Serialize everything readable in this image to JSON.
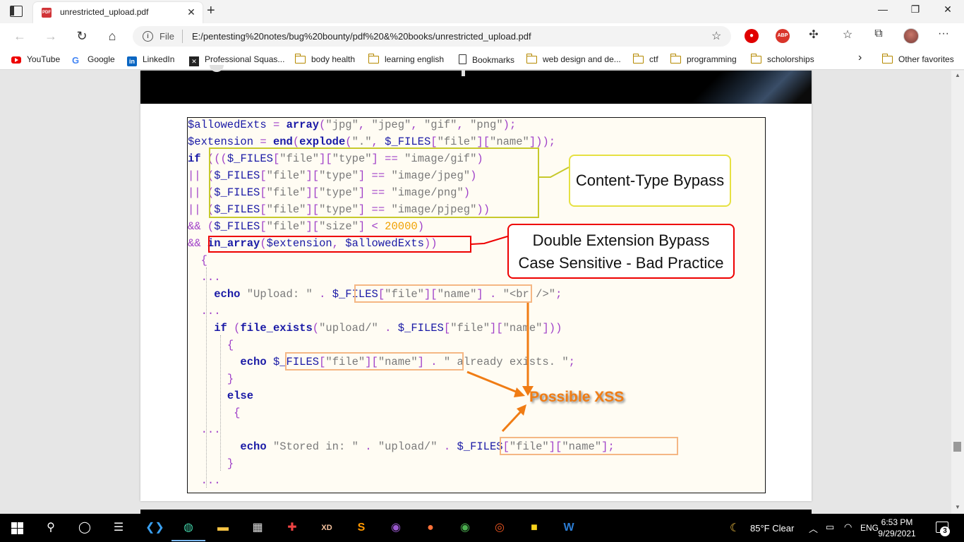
{
  "browser": {
    "tab": {
      "title": "unrestricted_upload.pdf",
      "close": "✕"
    },
    "new_tab": "+",
    "window": {
      "minimize": "—",
      "restore": "❐",
      "close": "✕"
    },
    "address": {
      "scheme_label": "File",
      "url": "E:/pentesting%20notes/bug%20bounty/pdf%20&%20books/unrestricted_upload.pdf"
    },
    "extensions": [
      {
        "name": "ublock-icon",
        "label": "",
        "color": "#e00000"
      },
      {
        "name": "adblock-plus-icon",
        "label": "ABP",
        "color": "#d9352b"
      }
    ],
    "bookmarks": [
      {
        "label": "YouTube",
        "icon": "youtube-icon"
      },
      {
        "label": "Google",
        "icon": "google-icon"
      },
      {
        "label": "LinkedIn",
        "icon": "linkedin-icon"
      },
      {
        "label": "Professional Squas...",
        "icon": "professional-squash-icon"
      },
      {
        "label": "body health",
        "icon": "folder-icon"
      },
      {
        "label": "learning english",
        "icon": "folder-icon"
      },
      {
        "label": "Bookmarks",
        "icon": "page-icon"
      },
      {
        "label": "web design and de...",
        "icon": "folder-icon"
      },
      {
        "label": "ctf",
        "icon": "folder-icon"
      },
      {
        "label": "programming",
        "icon": "folder-icon"
      },
      {
        "label": "scholorships",
        "icon": "folder-icon"
      },
      {
        "label": "Other favorites",
        "icon": "folder-icon"
      }
    ],
    "bookmarks_overflow": "›"
  },
  "pdf": {
    "code_lines": [
      "$allowedExts = array(\"jpg\", \"jpeg\", \"gif\", \"png\");",
      "$extension = end(explode(\".\", $_FILES[\"file\"][\"name\"]));",
      "if ((($_FILES[\"file\"][\"type\"] == \"image/gif\")",
      "|| ($_FILES[\"file\"][\"type\"] == \"image/jpeg\")",
      "|| ($_FILES[\"file\"][\"type\"] == \"image/png\")",
      "|| ($_FILES[\"file\"][\"type\"] == \"image/pjpeg\"))",
      "&& ($_FILES[\"file\"][\"size\"] < 20000)",
      "&& in_array($extension, $allowedExts))",
      "  {",
      "  ...",
      "    echo \"Upload: \" . $_FILES[\"file\"][\"name\"] . \"<br />\";",
      "  ...",
      "    if (file_exists(\"upload/\" . $_FILES[\"file\"][\"name\"]))",
      "      {",
      "        echo $_FILES[\"file\"][\"name\"] . \" already exists. \";",
      "      }",
      "      else",
      "       {",
      "  ...",
      "        echo \"Stored in: \" . \"upload/\" . $_FILES[\"file\"][\"name\"];",
      "      }",
      "  ..."
    ],
    "callouts": {
      "content_type": "Content-Type Bypass",
      "double_ext_line1": "Double Extension Bypass",
      "double_ext_line2": "Case Sensitive - Bad Practice",
      "xss": "Possible XSS"
    },
    "colors": {
      "keyword": "#1a1aa6",
      "string": "#7a7a7a",
      "number": "#f0a000",
      "operator": "#a040c8",
      "yellow_box": "#c7c92c",
      "red_box": "#e00000",
      "orange_box": "#f5b784",
      "arrow": "#f07c14"
    }
  },
  "taskbar": {
    "apps": [
      "search-icon",
      "cortana-icon",
      "task-view-icon",
      "vscode-icon",
      "edge-icon",
      "file-explorer-icon",
      "store-icon",
      "game-icon",
      "xd-icon",
      "sublime-icon",
      "tor-icon",
      "firefox-icon",
      "chrome-icon",
      "ubuntu-icon",
      "sticky-notes-icon",
      "word-icon"
    ],
    "weather": "85°F  Clear",
    "language": "ENG",
    "time": "6:53 PM",
    "date": "9/29/2021",
    "notifications": "3"
  }
}
